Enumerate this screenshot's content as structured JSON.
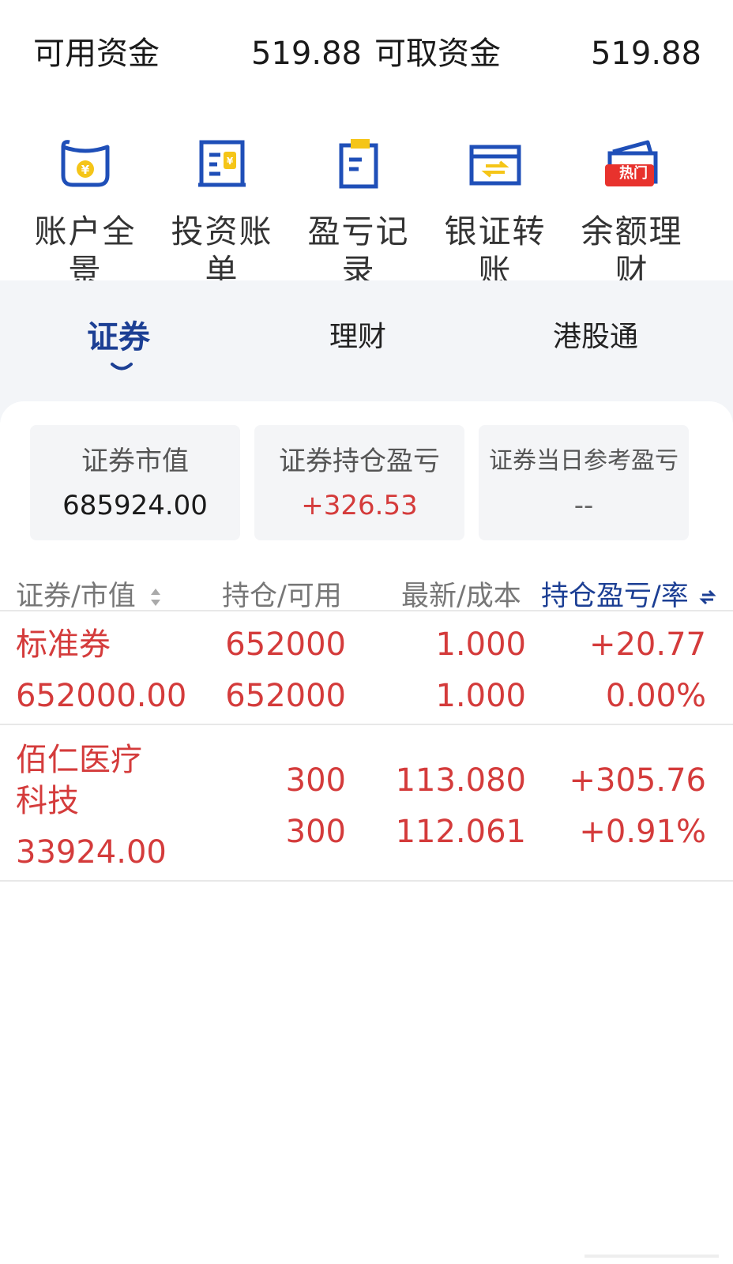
{
  "funds": {
    "available_label": "可用资金",
    "available_value": "519.88",
    "withdrawable_label": "可取资金",
    "withdrawable_value": "519.88"
  },
  "quick_actions": [
    {
      "label": "账户全景",
      "icon": "wallet-icon"
    },
    {
      "label": "投资账单",
      "icon": "bill-icon"
    },
    {
      "label": "盈亏记录",
      "icon": "clipboard-icon"
    },
    {
      "label": "银证转账",
      "icon": "transfer-card-icon"
    },
    {
      "label": "余额理财",
      "icon": "wallet-hot-icon",
      "badge": "热门"
    }
  ],
  "tabs": [
    {
      "label": "证券",
      "active": true
    },
    {
      "label": "理财",
      "active": false
    },
    {
      "label": "港股通",
      "active": false
    }
  ],
  "summary": [
    {
      "label": "证券市值",
      "value": "685924.00"
    },
    {
      "label": "证券持仓盈亏",
      "value": "+326.53"
    },
    {
      "label": "证券当日参考盈亏",
      "value": "--"
    }
  ],
  "table": {
    "headers": [
      "证券/市值",
      "持仓/可用",
      "最新/成本",
      "持仓盈亏/率"
    ],
    "rows": [
      {
        "name_line1": "标准券",
        "name_line2": "",
        "market_value": "652000.00",
        "position": "652000",
        "available": "652000",
        "latest": "1.000",
        "cost": "1.000",
        "pnl": "+20.77",
        "pnl_rate": "0.00%"
      },
      {
        "name_line1": "佰仁医疗",
        "name_line2": "科技",
        "market_value": "33924.00",
        "position": "300",
        "available": "300",
        "latest": "113.080",
        "cost": "112.061",
        "pnl": "+305.76",
        "pnl_rate": "+0.91%"
      }
    ]
  },
  "colors": {
    "accent_blue": "#1c3f94",
    "icon_blue": "#1f4fb8",
    "icon_yellow": "#f5c518",
    "gain_red": "#d43b3b",
    "hot_badge": "#e8322d"
  }
}
